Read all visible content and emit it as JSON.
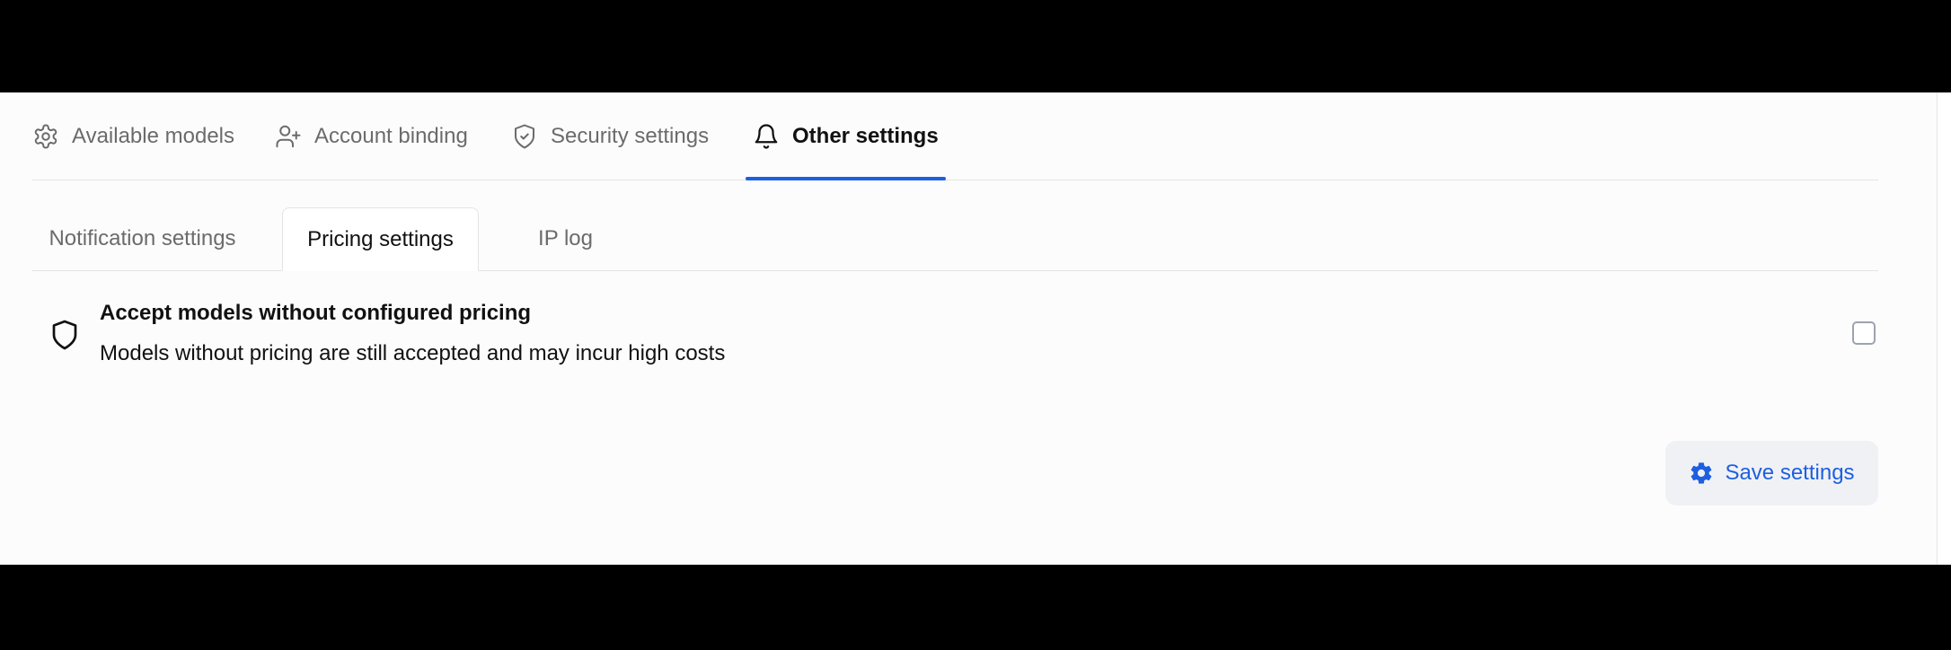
{
  "main_tabs": [
    {
      "label": "Available models",
      "icon": "gear-icon",
      "active": false
    },
    {
      "label": "Account binding",
      "icon": "user-plus-icon",
      "active": false
    },
    {
      "label": "Security settings",
      "icon": "shield-check-icon",
      "active": false
    },
    {
      "label": "Other settings",
      "icon": "bell-icon",
      "active": true
    }
  ],
  "sub_tabs": [
    {
      "label": "Notification settings",
      "active": false
    },
    {
      "label": "Pricing settings",
      "active": true
    },
    {
      "label": "IP log",
      "active": false
    }
  ],
  "setting": {
    "icon": "shield-icon",
    "title": "Accept models without configured pricing",
    "description": "Models without pricing are still accepted and may incur high costs",
    "checked": false
  },
  "save_button": {
    "label": "Save settings",
    "icon": "gear-icon"
  },
  "colors": {
    "accent": "#1d5fe0",
    "button_bg": "#f0f1f4"
  }
}
